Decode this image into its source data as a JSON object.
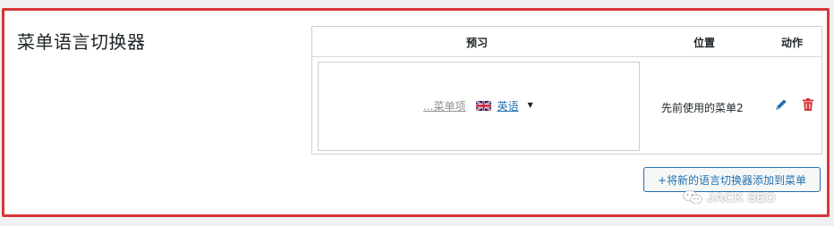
{
  "section": {
    "title": "菜单语言切换器"
  },
  "table": {
    "headers": {
      "preview": "预习",
      "position": "位置",
      "action": "动作"
    },
    "rows": [
      {
        "preview": {
          "menu_item_text": "...菜单项",
          "flag_icon": "uk-flag-icon",
          "language_text": "英语",
          "caret": "▼"
        },
        "position": "先前使用的菜单2",
        "actions": {
          "edit_icon": "pencil-icon",
          "delete_icon": "trash-icon"
        }
      }
    ]
  },
  "add_button": {
    "label": "+将新的语言切换器添加到菜单"
  },
  "watermark": {
    "text": "JACK SEO",
    "icon": "wechat-icon"
  },
  "colors": {
    "highlight_border": "#d63638",
    "link_blue": "#2271b1",
    "edit_icon": "#2271b1",
    "delete_icon": "#d63638"
  }
}
